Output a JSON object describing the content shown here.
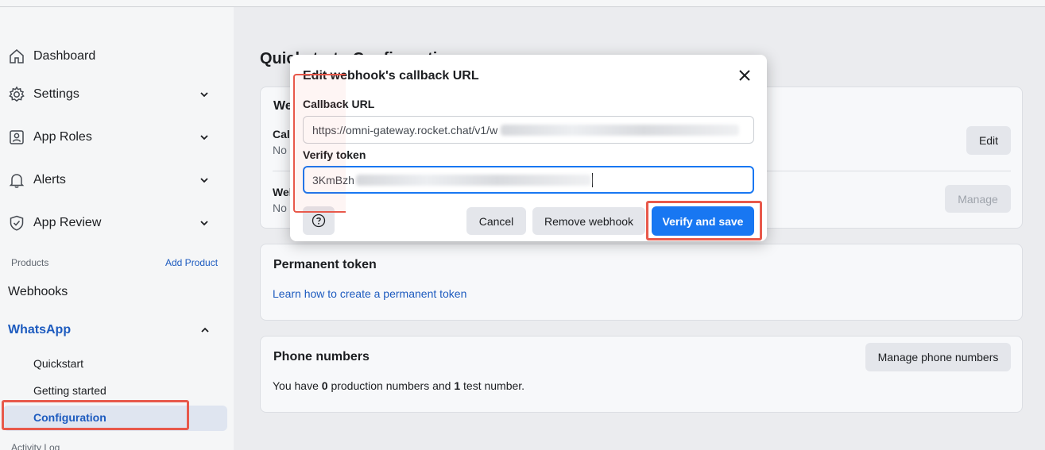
{
  "sidebar": {
    "items": [
      {
        "label": "Dashboard",
        "icon": "home-icon"
      },
      {
        "label": "Settings",
        "icon": "gear-icon"
      },
      {
        "label": "App Roles",
        "icon": "user-badge-icon"
      },
      {
        "label": "Alerts",
        "icon": "bell-icon"
      },
      {
        "label": "App Review",
        "icon": "shield-check-icon"
      }
    ],
    "products_label": "Products",
    "add_product_label": "Add Product",
    "webhooks_label": "Webhooks",
    "whatsapp_label": "WhatsApp",
    "whatsapp_sub": [
      "Quickstart",
      "Getting started",
      "Configuration"
    ],
    "activity_log_label": "Activity Log"
  },
  "main": {
    "page_title": "Quickstart › Configuration",
    "webhook_card": {
      "title_fragment": "We",
      "row1_label_fragment": "Cal",
      "row1_value_fragment": "No",
      "row2_label_fragment": "Wel",
      "row2_value_fragment": "No",
      "edit_label": "Edit",
      "manage_label": "Manage"
    },
    "permanent_token": {
      "title": "Permanent token",
      "link_label": "Learn how to create a permanent token"
    },
    "phone_numbers": {
      "title": "Phone numbers",
      "manage_label": "Manage phone numbers",
      "text_before": "You have ",
      "production_count": "0",
      "text_middle": " production numbers and ",
      "test_count": "1",
      "text_after": " test number."
    }
  },
  "modal": {
    "title": "Edit webhook's callback URL",
    "callback_label": "Callback URL",
    "callback_value": "https://omni-gateway.rocket.chat/v1/w",
    "verify_label": "Verify token",
    "verify_value": "3KmBzh",
    "cancel_label": "Cancel",
    "remove_label": "Remove webhook",
    "save_label": "Verify and save"
  },
  "colors": {
    "accent": "#1877f2",
    "link": "#1d5bbf",
    "highlight_red": "#e8594b"
  }
}
